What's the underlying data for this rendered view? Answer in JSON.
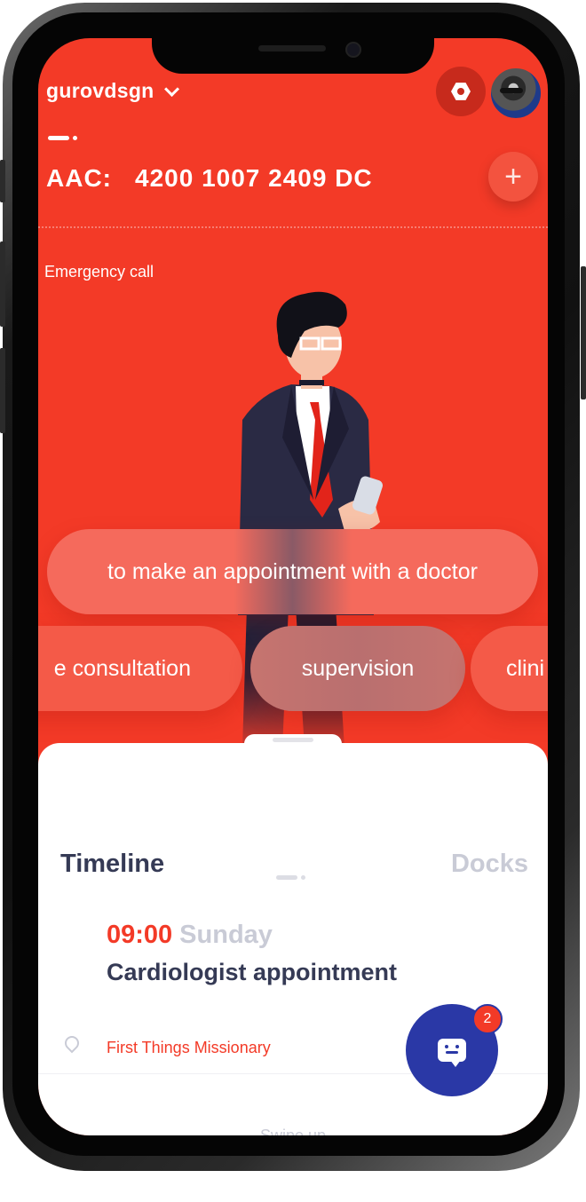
{
  "header": {
    "account_name": "gurovdsgn",
    "aac_label": "AAC:",
    "aac_number": "4200 1007 2409 DC",
    "add_symbol": "+",
    "emergency_label": "Emergency call"
  },
  "chips": {
    "main": "to make an appointment with a doctor",
    "left": "e consultation",
    "center": "supervision",
    "right": "clini"
  },
  "panel": {
    "tab_timeline": "Timeline",
    "tab_docks": "Docks",
    "event": {
      "time": "09:00",
      "day": "Sunday",
      "title": "Cardiologist appointment",
      "location": "First Things Missionary"
    },
    "swipe_hint": "Swipe up"
  },
  "chat": {
    "badge_count": "2"
  },
  "colors": {
    "accent_red": "#f33a27",
    "chat_blue": "#2a38a6",
    "text_dark": "#353a55",
    "text_muted": "#c9cbd6"
  },
  "icons": [
    "chevron-down-icon",
    "hexagon-settings-icon",
    "plus-icon",
    "location-pin-icon",
    "chat-icon"
  ]
}
